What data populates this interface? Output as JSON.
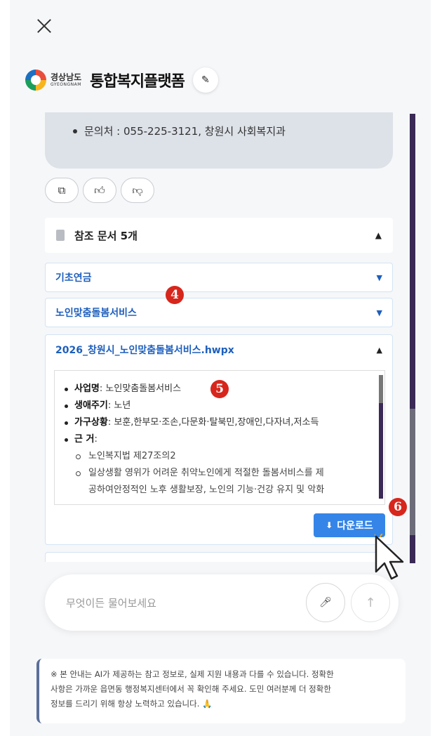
{
  "header": {
    "close_icon": "close-icon",
    "logo_korean": "경상남도",
    "logo_english": "GYEONGNAM",
    "title": "통합복지플랫폼",
    "edit_icon": "pencil-icon"
  },
  "chat": {
    "contact_line": "문의처 : 055-225-3121, 창원시 사회복지과",
    "reactions": {
      "copy_icon": "copy-icon",
      "like_icon": "thumbs-up-icon",
      "dislike_icon": "thumbs-down-icon"
    },
    "references": {
      "title": "참조 문서 5개",
      "items": [
        {
          "label": "기초연금",
          "expanded": false
        },
        {
          "label": "노인맞춤돌봄서비스",
          "expanded": false
        },
        {
          "label": "2026_창원시_노인맞춤돌봄서비스.hwpx",
          "expanded": true
        }
      ],
      "document": {
        "business_name_label": "사업명",
        "business_name_value": ": 노인맞춤돌봄서비스",
        "life_cycle_label": "생애주기",
        "life_cycle_value": ": 노년",
        "household_label": "가구상황",
        "household_value": ": 보훈,한부모·조손,다문화·탈북민,장애인,다자녀,저소득",
        "basis_label": "근 거",
        "basis_value": ":",
        "basis_items": [
          "노인복지법 제27조의2",
          "일상생활 영위가 어려운 취약노인에게 적절한 돌봄서비스를 제"
        ],
        "basis_item_cont": "공하여안정적인 노후 생활보장, 노인의 기능·건강 유지 및 악화"
      },
      "download_label": "다운로드"
    },
    "markers": [
      "4",
      "5",
      "6"
    ]
  },
  "input": {
    "placeholder": "무엇이든 물어보세요",
    "mic_icon": "mic-icon",
    "send_icon": "send-arrow-icon"
  },
  "disclaimer": {
    "line1": "※ 본 안내는 AI가 제공하는 참고 정보로, 실제 지원 내용과 다를 수 있습니다. 정확한",
    "line2": "사항은 가까운 읍면동 행정복지센터에서 꼭 확인해 주세요. 도민 여러분께 더 정확한",
    "line3": "정보를 드리기 위해 항상 노력하고 있습니다. 🙏"
  },
  "colors": {
    "accent": "#3585e8",
    "link": "#1e5fbd",
    "scrollbar": "#3a2a55",
    "marker": "#d7261c"
  }
}
